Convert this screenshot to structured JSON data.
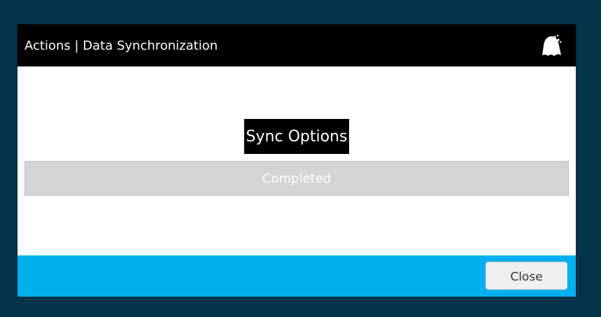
{
  "dialog": {
    "title": "Actions | Data Synchronization",
    "logo_icon": "bell-logo-icon"
  },
  "content": {
    "section_title": "Sync Options",
    "status_text": "Completed"
  },
  "footer": {
    "close_label": "Close"
  },
  "colors": {
    "background": "#04344a",
    "titlebar": "#000000",
    "footer": "#02b0ef",
    "status_bar": "#d4d4d4"
  }
}
